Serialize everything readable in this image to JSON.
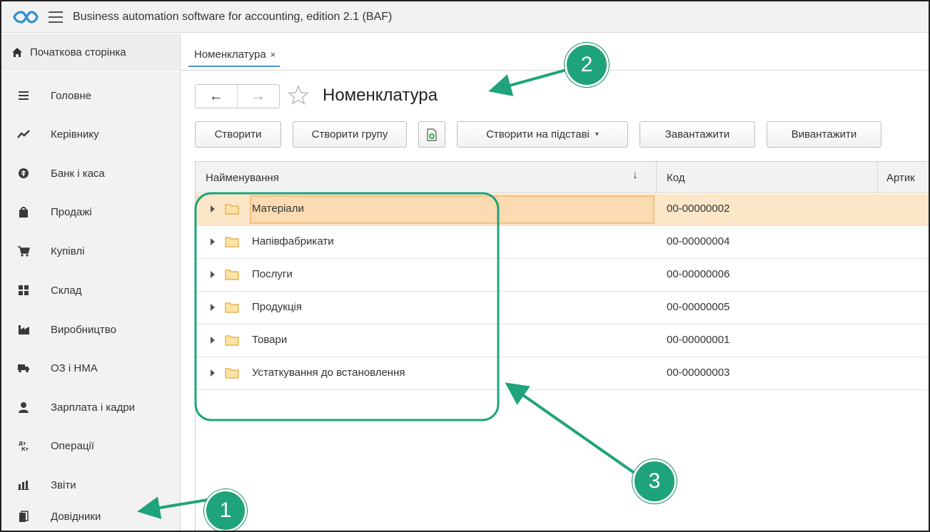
{
  "app": {
    "title": "Business automation software for accounting, edition 2.1  (BAF)",
    "logo_icon": "baf-logo-icon",
    "menu_icon": "hamburger-icon"
  },
  "tabs": {
    "home_label": "Початкова сторінка",
    "home_icon": "home-icon",
    "open": [
      {
        "label": "Номенклатура",
        "close": "×"
      }
    ]
  },
  "sidebar": {
    "items": [
      {
        "label": "Головне",
        "icon": "menu-lines-icon"
      },
      {
        "label": "Керівнику",
        "icon": "trend-chart-icon"
      },
      {
        "label": "Банк і каса",
        "icon": "coin-icon"
      },
      {
        "label": "Продажі",
        "icon": "shopping-bag-icon"
      },
      {
        "label": "Купівлі",
        "icon": "cart-icon"
      },
      {
        "label": "Склад",
        "icon": "warehouse-icon"
      },
      {
        "label": "Виробництво",
        "icon": "factory-icon"
      },
      {
        "label": "ОЗ і НМА",
        "icon": "truck-icon"
      },
      {
        "label": "Зарплата і кадри",
        "icon": "person-icon"
      },
      {
        "label": "Операції",
        "icon": "debit-credit-icon"
      },
      {
        "label": "Звіти",
        "icon": "bar-chart-icon"
      },
      {
        "label": "Довідники",
        "icon": "books-icon"
      }
    ]
  },
  "page": {
    "title": "Номенклатура",
    "back": "←",
    "forward": "→",
    "favorite_icon": "star-icon"
  },
  "toolbar": {
    "create": "Створити",
    "create_group": "Створити групу",
    "copy_icon": "add-copy-icon",
    "create_based_on": "Створити на підставі",
    "create_based_on_caret": "▾",
    "load": "Завантажити",
    "unload": "Вивантажити"
  },
  "table": {
    "columns": [
      "Найменування",
      "Код",
      "Артик"
    ],
    "sort_indicator": "↓",
    "rows": [
      {
        "name": "Матеріали",
        "code": "00-00000002",
        "selected": true
      },
      {
        "name": "Напівфабрикати",
        "code": "00-00000004",
        "selected": false
      },
      {
        "name": "Послуги",
        "code": "00-00000006",
        "selected": false
      },
      {
        "name": "Продукція",
        "code": "00-00000005",
        "selected": false
      },
      {
        "name": "Товари",
        "code": "00-00000001",
        "selected": false
      },
      {
        "name": "Устаткування до встановлення",
        "code": "00-00000003",
        "selected": false
      }
    ]
  },
  "annotations": {
    "badge_1": "1",
    "badge_2": "2",
    "badge_3": "3",
    "color": "#1fa37a"
  },
  "colors": {
    "selection": "#fbdcb2",
    "folder": "#f2c66d",
    "tab_underline": "#4a8fd4"
  }
}
